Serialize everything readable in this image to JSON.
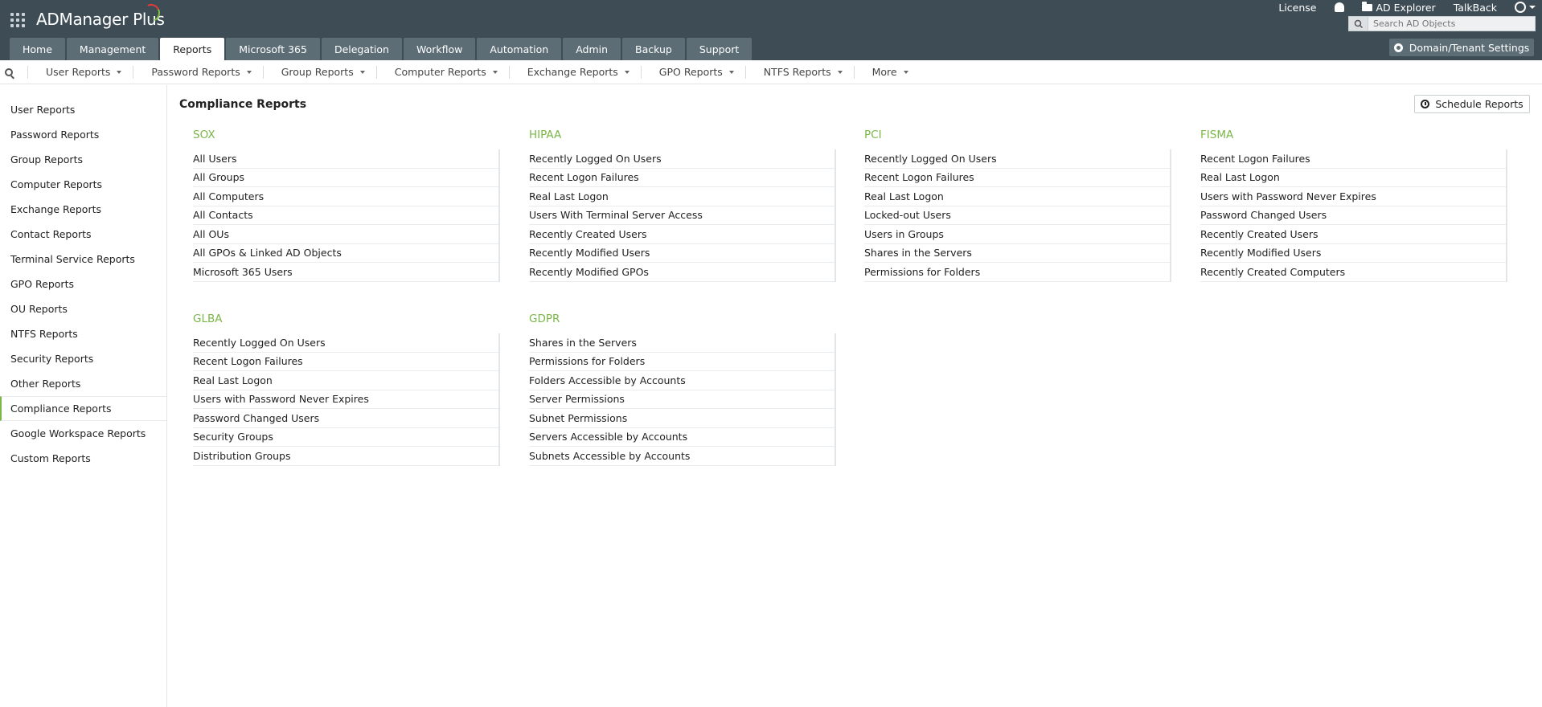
{
  "app": {
    "name": "ADManager Plus"
  },
  "top_links": {
    "license": "License",
    "ad_explorer": "AD Explorer",
    "talkback": "TalkBack"
  },
  "search": {
    "placeholder": "Search AD Objects"
  },
  "main_tabs": [
    {
      "label": "Home"
    },
    {
      "label": "Management"
    },
    {
      "label": "Reports",
      "active": true
    },
    {
      "label": "Microsoft 365"
    },
    {
      "label": "Delegation"
    },
    {
      "label": "Workflow"
    },
    {
      "label": "Automation"
    },
    {
      "label": "Admin"
    },
    {
      "label": "Backup"
    },
    {
      "label": "Support"
    }
  ],
  "domain_settings": {
    "label": "Domain/Tenant Settings"
  },
  "subnav": [
    {
      "label": "User Reports"
    },
    {
      "label": "Password Reports"
    },
    {
      "label": "Group Reports"
    },
    {
      "label": "Computer Reports"
    },
    {
      "label": "Exchange Reports"
    },
    {
      "label": "GPO Reports"
    },
    {
      "label": "NTFS Reports"
    },
    {
      "label": "More"
    }
  ],
  "sidebar": {
    "items": [
      {
        "label": "User Reports"
      },
      {
        "label": "Password Reports"
      },
      {
        "label": "Group Reports"
      },
      {
        "label": "Computer Reports"
      },
      {
        "label": "Exchange Reports"
      },
      {
        "label": "Contact Reports"
      },
      {
        "label": "Terminal Service Reports"
      },
      {
        "label": "GPO Reports"
      },
      {
        "label": "OU Reports"
      },
      {
        "label": "NTFS Reports"
      },
      {
        "label": "Security Reports"
      },
      {
        "label": "Other Reports"
      },
      {
        "label": "Compliance Reports",
        "active": true
      },
      {
        "label": "Google Workspace Reports"
      },
      {
        "label": "Custom Reports"
      }
    ]
  },
  "main": {
    "title": "Compliance Reports",
    "schedule_label": "Schedule Reports",
    "sections": [
      {
        "title": "SOX",
        "items": [
          "All Users",
          "All Groups",
          "All Computers",
          "All Contacts",
          "All OUs",
          "All GPOs & Linked AD Objects",
          "Microsoft 365 Users"
        ]
      },
      {
        "title": "HIPAA",
        "items": [
          "Recently Logged On Users",
          "Recent Logon Failures",
          "Real Last Logon",
          "Users With Terminal Server Access",
          "Recently Created Users",
          "Recently Modified Users",
          "Recently Modified GPOs"
        ]
      },
      {
        "title": "PCI",
        "items": [
          "Recently Logged On Users",
          "Recent Logon Failures",
          "Real Last Logon",
          "Locked-out Users",
          "Users in Groups",
          "Shares in the Servers",
          "Permissions for Folders"
        ]
      },
      {
        "title": "FISMA",
        "items": [
          "Recent Logon Failures",
          "Real Last Logon",
          "Users with Password Never Expires",
          "Password Changed Users",
          "Recently Created Users",
          "Recently Modified Users",
          "Recently Created Computers"
        ]
      },
      {
        "title": "GLBA",
        "items": [
          "Recently Logged On Users",
          "Recent Logon Failures",
          "Real Last Logon",
          "Users with Password Never Expires",
          "Password Changed Users",
          "Security Groups",
          "Distribution Groups"
        ]
      },
      {
        "title": "GDPR",
        "items": [
          "Shares in the Servers",
          "Permissions for Folders",
          "Folders Accessible by Accounts",
          "Server Permissions",
          "Subnet Permissions",
          "Servers Accessible by Accounts",
          "Subnets Accessible by Accounts"
        ]
      }
    ]
  },
  "colors": {
    "header_bg": "#3d4c55",
    "tab_bg": "#5c6d76",
    "accent_green": "#7ab648"
  }
}
